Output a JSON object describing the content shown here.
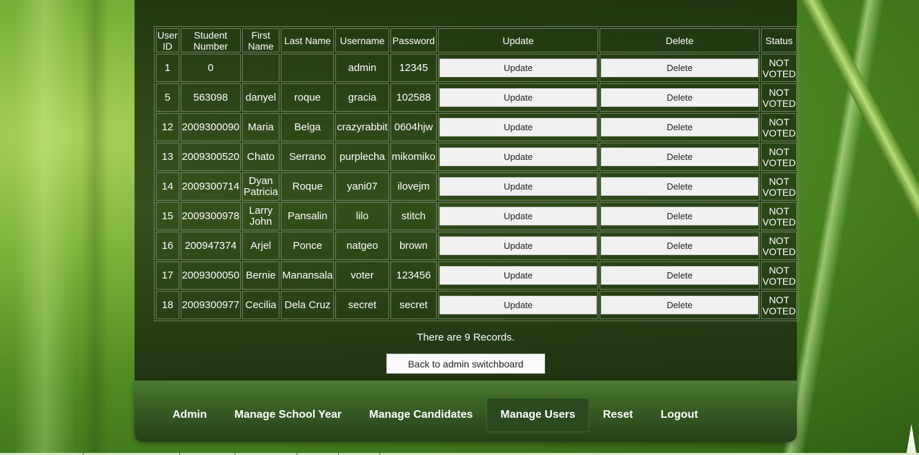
{
  "table": {
    "headers": [
      "User ID",
      "Student Number",
      "First Name",
      "Last Name",
      "Username",
      "Password",
      "Update",
      "Delete",
      "Status"
    ],
    "rows": [
      {
        "id": "1",
        "student": "0",
        "first": "",
        "last": "",
        "username": "admin",
        "password": "12345",
        "update": "Update",
        "delete": "Delete",
        "status": "NOT VOTED"
      },
      {
        "id": "5",
        "student": "563098",
        "first": "danyel",
        "last": "roque",
        "username": "gracia",
        "password": "102588",
        "update": "Update",
        "delete": "Delete",
        "status": "NOT VOTED"
      },
      {
        "id": "12",
        "student": "2009300090",
        "first": "Maria",
        "last": "Belga",
        "username": "crazyrabbit",
        "password": "0604hjw",
        "update": "Update",
        "delete": "Delete",
        "status": "NOT VOTED"
      },
      {
        "id": "13",
        "student": "2009300520",
        "first": "Chato",
        "last": "Serrano",
        "username": "purplecha",
        "password": "mikomiko",
        "update": "Update",
        "delete": "Delete",
        "status": "NOT VOTED"
      },
      {
        "id": "14",
        "student": "2009300714",
        "first": "Dyan Patricia",
        "last": "Roque",
        "username": "yani07",
        "password": "ilovejm",
        "update": "Update",
        "delete": "Delete",
        "status": "NOT VOTED"
      },
      {
        "id": "15",
        "student": "2009300978",
        "first": "Larry John",
        "last": "Pansalin",
        "username": "lilo",
        "password": "stitch",
        "update": "Update",
        "delete": "Delete",
        "status": "NOT VOTED"
      },
      {
        "id": "16",
        "student": "200947374",
        "first": "Arjel",
        "last": "Ponce",
        "username": "natgeo",
        "password": "brown",
        "update": "Update",
        "delete": "Delete",
        "status": "NOT VOTED"
      },
      {
        "id": "17",
        "student": "2009300050",
        "first": "Bernie",
        "last": "Manansala",
        "username": "voter",
        "password": "123456",
        "update": "Update",
        "delete": "Delete",
        "status": "NOT VOTED"
      },
      {
        "id": "18",
        "student": "2009300977",
        "first": "Cecilia",
        "last": "Dela Cruz",
        "username": "secret",
        "password": "secret",
        "update": "Update",
        "delete": "Delete",
        "status": "NOT VOTED"
      }
    ]
  },
  "records_text": "There are 9 Records.",
  "back_button": "Back to admin switchboard",
  "nav": {
    "items": [
      "Admin",
      "Manage School Year",
      "Manage Candidates",
      "Manage Users",
      "Reset",
      "Logout"
    ],
    "active": "Manage Users"
  }
}
